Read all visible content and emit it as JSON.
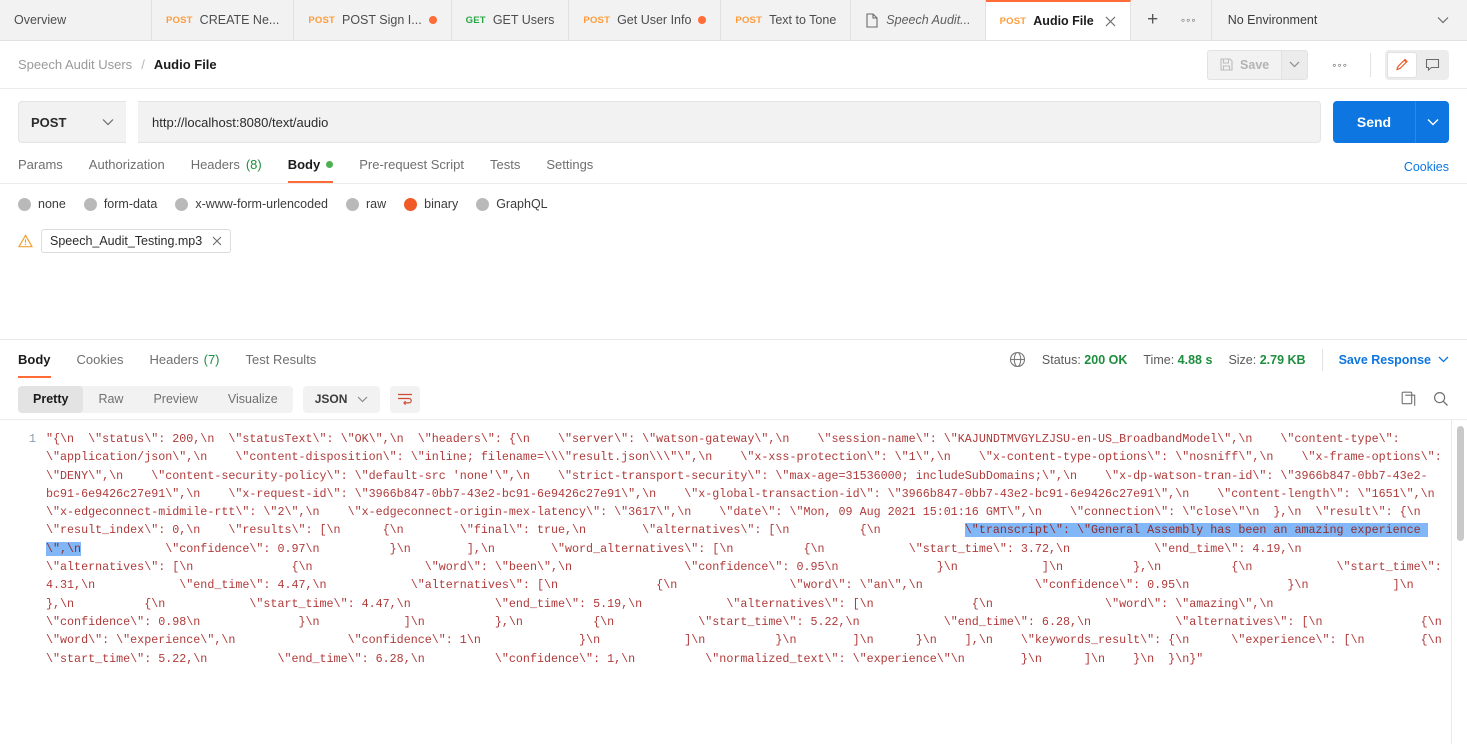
{
  "window": {
    "tabs": [
      {
        "label": "Overview",
        "method": "",
        "unsaved": false,
        "active": false,
        "italic": false,
        "doc": false
      },
      {
        "label": "CREATE Ne...",
        "method": "POST",
        "unsaved": false,
        "active": false,
        "italic": false,
        "doc": false
      },
      {
        "label": "POST Sign I...",
        "method": "POST",
        "unsaved": true,
        "active": false,
        "italic": false,
        "doc": false
      },
      {
        "label": "GET Users",
        "method": "GET",
        "unsaved": false,
        "active": false,
        "italic": false,
        "doc": false
      },
      {
        "label": "Get User Info",
        "method": "POST",
        "unsaved": true,
        "active": false,
        "italic": false,
        "doc": false
      },
      {
        "label": "Text to Tone",
        "method": "POST",
        "unsaved": false,
        "active": false,
        "italic": false,
        "doc": false
      },
      {
        "label": "Speech Audit...",
        "method": "",
        "unsaved": false,
        "active": false,
        "italic": true,
        "doc": true
      },
      {
        "label": "Audio File",
        "method": "POST",
        "unsaved": false,
        "active": true,
        "italic": false,
        "doc": false
      }
    ],
    "new_tab_icon": "plus-icon",
    "tab_options_icon": "ellipsis-icon",
    "environment": "No Environment"
  },
  "breadcrumb": {
    "collection": "Speech Audit Users",
    "separator": "/",
    "request": "Audio File",
    "save_label": "Save",
    "save_icon": "floppy-disk-icon",
    "save_caret_icon": "chevron-down-icon",
    "more_icon": "ellipsis-icon",
    "edit_icon": "pencil-icon",
    "comment_icon": "comment-icon"
  },
  "request": {
    "method": "POST",
    "method_caret_icon": "chevron-down-icon",
    "url": "http://localhost:8080/text/audio",
    "send_label": "Send",
    "send_caret_icon": "chevron-down-icon",
    "tabs": [
      {
        "label": "Params",
        "count": "",
        "dot": false,
        "active": false
      },
      {
        "label": "Authorization",
        "count": "",
        "dot": false,
        "active": false
      },
      {
        "label": "Headers",
        "count": "(8)",
        "dot": false,
        "active": false
      },
      {
        "label": "Body",
        "count": "",
        "dot": true,
        "active": true
      },
      {
        "label": "Pre-request Script",
        "count": "",
        "dot": false,
        "active": false
      },
      {
        "label": "Tests",
        "count": "",
        "dot": false,
        "active": false
      },
      {
        "label": "Settings",
        "count": "",
        "dot": false,
        "active": false
      }
    ],
    "cookies_link": "Cookies",
    "body_types": [
      {
        "label": "none",
        "selected": false
      },
      {
        "label": "form-data",
        "selected": false
      },
      {
        "label": "x-www-form-urlencoded",
        "selected": false
      },
      {
        "label": "raw",
        "selected": false
      },
      {
        "label": "binary",
        "selected": true
      },
      {
        "label": "GraphQL",
        "selected": false
      }
    ],
    "file": {
      "warn_icon": "warning-triangle-icon",
      "name": "Speech_Audit_Testing.mp3",
      "remove_icon": "close-icon"
    }
  },
  "response": {
    "tabs": [
      {
        "label": "Body",
        "count": "",
        "active": true
      },
      {
        "label": "Cookies",
        "count": "",
        "active": false
      },
      {
        "label": "Headers",
        "count": "(7)",
        "active": false
      },
      {
        "label": "Test Results",
        "count": "",
        "active": false
      }
    ],
    "network_icon": "globe-icon",
    "status_label": "Status:",
    "status_value": "200 OK",
    "time_label": "Time:",
    "time_value": "4.88 s",
    "size_label": "Size:",
    "size_value": "2.79 KB",
    "save_response_label": "Save Response",
    "save_response_caret_icon": "chevron-down-icon",
    "view_modes": [
      {
        "label": "Pretty",
        "selected": true
      },
      {
        "label": "Raw",
        "selected": false
      },
      {
        "label": "Preview",
        "selected": false
      },
      {
        "label": "Visualize",
        "selected": false
      }
    ],
    "format": "JSON",
    "format_caret_icon": "chevron-down-icon",
    "wrap_icon": "word-wrap-icon",
    "copy_icon": "copy-icon",
    "search_icon": "search-icon",
    "line_number": "1",
    "body_before_highlight": "\"{\\n  \\\"status\\\": 200,\\n  \\\"statusText\\\": \\\"OK\\\",\\n  \\\"headers\\\": {\\n    \\\"server\\\": \\\"watson-gateway\\\",\\n    \\\"session-name\\\": \\\"KAJUNDTMVGYLZJSU-en-US_BroadbandModel\\\",\\n    \\\"content-type\\\": \\\"application/json\\\",\\n    \\\"content-disposition\\\": \\\"inline; filename=\\\\\\\"result.json\\\\\\\"\\\",\\n    \\\"x-xss-protection\\\": \\\"1\\\",\\n    \\\"x-content-type-options\\\": \\\"nosniff\\\",\\n    \\\"x-frame-options\\\": \\\"DENY\\\",\\n    \\\"content-security-policy\\\": \\\"default-src 'none'\\\",\\n    \\\"strict-transport-security\\\": \\\"max-age=31536000; includeSubDomains;\\\",\\n    \\\"x-dp-watson-tran-id\\\": \\\"3966b847-0bb7-43e2-bc91-6e9426c27e91\\\",\\n    \\\"x-request-id\\\": \\\"3966b847-0bb7-43e2-bc91-6e9426c27e91\\\",\\n    \\\"x-global-transaction-id\\\": \\\"3966b847-0bb7-43e2-bc91-6e9426c27e91\\\",\\n    \\\"content-length\\\": \\\"1651\\\",\\n    \\\"x-edgeconnect-midmile-rtt\\\": \\\"2\\\",\\n    \\\"x-edgeconnect-origin-mex-latency\\\": \\\"3617\\\",\\n    \\\"date\\\": \\\"Mon, 09 Aug 2021 15:01:16 GMT\\\",\\n    \\\"connection\\\": \\\"close\\\"\\n  },\\n  \\\"result\\\": {\\n    \\\"result_index\\\": 0,\\n    \\\"results\\\": [\\n      {\\n        \\\"final\\\": true,\\n        \\\"alternatives\\\": [\\n          {\\n            ",
    "body_highlight": "\\\"transcript\\\": \\\"General Assembly has been an amazing experience \\\",\\n",
    "body_after_highlight": "            \\\"confidence\\\": 0.97\\n          }\\n        ],\\n        \\\"word_alternatives\\\": [\\n          {\\n            \\\"start_time\\\": 3.72,\\n            \\\"end_time\\\": 4.19,\\n            \\\"alternatives\\\": [\\n              {\\n                \\\"word\\\": \\\"been\\\",\\n                \\\"confidence\\\": 0.95\\n              }\\n            ]\\n          },\\n          {\\n            \\\"start_time\\\": 4.31,\\n            \\\"end_time\\\": 4.47,\\n            \\\"alternatives\\\": [\\n              {\\n                \\\"word\\\": \\\"an\\\",\\n                \\\"confidence\\\": 0.95\\n              }\\n            ]\\n          },\\n          {\\n            \\\"start_time\\\": 4.47,\\n            \\\"end_time\\\": 5.19,\\n            \\\"alternatives\\\": [\\n              {\\n                \\\"word\\\": \\\"amazing\\\",\\n                \\\"confidence\\\": 0.98\\n              }\\n            ]\\n          },\\n          {\\n            \\\"start_time\\\": 5.22,\\n            \\\"end_time\\\": 6.28,\\n            \\\"alternatives\\\": [\\n              {\\n                \\\"word\\\": \\\"experience\\\",\\n                \\\"confidence\\\": 1\\n              }\\n            ]\\n          }\\n        ]\\n      }\\n    ],\\n    \\\"keywords_result\\\": {\\n      \\\"experience\\\": [\\n        {\\n          \\\"start_time\\\": 5.22,\\n          \\\"end_time\\\": 6.28,\\n          \\\"confidence\\\": 1,\\n          \\\"normalized_text\\\": \\\"experience\\\"\\n        }\\n      ]\\n    }\\n  }\\n}\""
  },
  "colors": {
    "accent_orange": "#ff6c37",
    "send_blue": "#0d76e0",
    "status_green": "#1e8e3e",
    "code_red": "#b03a3a",
    "highlight_blue": "#82b7f7"
  }
}
